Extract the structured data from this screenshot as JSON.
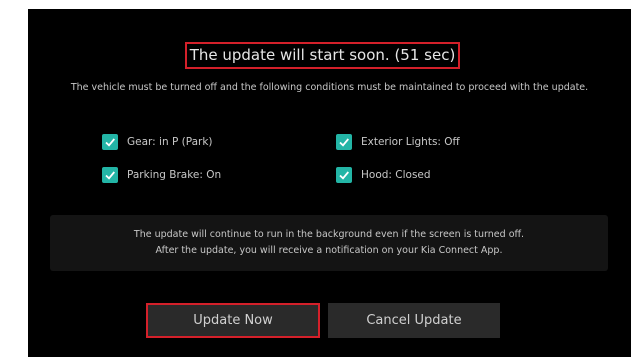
{
  "dialog": {
    "title": "The update will start soon. (51 sec)",
    "description": "The vehicle must be turned off and the following conditions must be maintained to proceed with the update.",
    "conditions": [
      {
        "label": "Gear: in P (Park)",
        "checked": true
      },
      {
        "label": "Exterior Lights: Off",
        "checked": true
      },
      {
        "label": "Parking Brake: On",
        "checked": true
      },
      {
        "label": "Hood: Closed",
        "checked": true
      }
    ],
    "note_line1": "The update will continue to run in the background even if the screen is turned off.",
    "note_line2": "After the update, you will receive a notification on your Kia Connect App.",
    "buttons": {
      "update_now": "Update Now",
      "cancel_update": "Cancel Update"
    }
  },
  "colors": {
    "highlight_border": "#d4202a",
    "checkbox": "#23b5a6",
    "background": "#000000"
  },
  "icons": {
    "checkbox": "check-icon"
  }
}
